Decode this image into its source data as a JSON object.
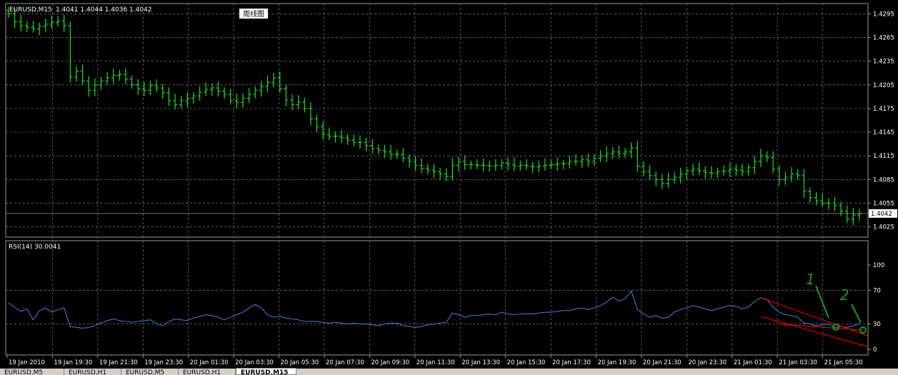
{
  "chart_data": [
    {
      "type": "bar",
      "subtype": "ohlc",
      "title": "EURUSD,M15",
      "ohlc_label": "1.4041 1.4044 1.4036 1.4042",
      "annotation": "周线图",
      "current_price_label": "1.4042",
      "ylim": [
        1.4012,
        1.4308
      ],
      "yticks": [
        "1.4295",
        "1.4265",
        "1.4235",
        "1.4205",
        "1.4175",
        "1.4145",
        "1.4115",
        "1.4085",
        "1.4055",
        "1.4025"
      ],
      "grid": true,
      "series": [
        {
          "values": [
            1.4295,
            1.4285,
            1.428,
            1.4278,
            1.4276,
            1.4279,
            1.4282,
            1.4284,
            1.4286,
            1.428,
            1.4215,
            1.4222,
            1.421,
            1.4198,
            1.4205,
            1.421,
            1.4214,
            1.4217,
            1.4218,
            1.4212,
            1.4205,
            1.42,
            1.4198,
            1.4204,
            1.4201,
            1.4195,
            1.4185,
            1.418,
            1.4185,
            1.4188,
            1.4191,
            1.4196,
            1.4199,
            1.4201,
            1.4197,
            1.4193,
            1.4185,
            1.4183,
            1.4188,
            1.4193,
            1.4198,
            1.4203,
            1.4208,
            1.4214,
            1.42,
            1.4186,
            1.418,
            1.4183,
            1.4175,
            1.4162,
            1.4152,
            1.4142,
            1.414,
            1.414,
            1.4138,
            1.4135,
            1.4132,
            1.4132,
            1.4128,
            1.4124,
            1.4122,
            1.412,
            1.4117,
            1.4117,
            1.4112,
            1.4108,
            1.4103,
            1.4099,
            1.4097,
            1.4095,
            1.4092,
            1.4089,
            1.4103,
            1.4108,
            1.4104,
            1.4104,
            1.4103,
            1.4103,
            1.4102,
            1.4103,
            1.4106,
            1.4104,
            1.4102,
            1.4103,
            1.4102,
            1.4101,
            1.4102,
            1.4103,
            1.4104,
            1.4105,
            1.4105,
            1.4108,
            1.4108,
            1.411,
            1.4108,
            1.4112,
            1.4115,
            1.4118,
            1.412,
            1.4118,
            1.412,
            1.4125,
            1.4102,
            1.4095,
            1.409,
            1.4085,
            1.408,
            1.4085,
            1.4088,
            1.4092,
            1.4096,
            1.4098,
            1.4096,
            1.4094,
            1.4093,
            1.4095,
            1.4096,
            1.4098,
            1.4097,
            1.4095,
            1.41,
            1.4108,
            1.4115,
            1.4113,
            1.4098,
            1.4085,
            1.4088,
            1.4092,
            1.409,
            1.407,
            1.4062,
            1.4058,
            1.4055,
            1.4055,
            1.4052,
            1.4045,
            1.4035,
            1.404,
            1.4042
          ]
        }
      ]
    },
    {
      "type": "line",
      "title": "RSI(14) 30.0041",
      "ylim": [
        0,
        100
      ],
      "yticks": [
        "100",
        "70",
        "30",
        "0"
      ],
      "levels": [
        70,
        30
      ],
      "grid": true,
      "series": [
        {
          "values": [
            55,
            50,
            45,
            48,
            35,
            46,
            49,
            44,
            47,
            49,
            27,
            26,
            25,
            26,
            28,
            31,
            34,
            36,
            34,
            33,
            32,
            33,
            34,
            35,
            30,
            28,
            33,
            36,
            35,
            34,
            37,
            39,
            41,
            40,
            38,
            35,
            38,
            41,
            44,
            49,
            53,
            49,
            41,
            38,
            39,
            37,
            36,
            35,
            33,
            33,
            33,
            32,
            31,
            32,
            31,
            30,
            31,
            30,
            30,
            29,
            28,
            30,
            31,
            31,
            28,
            27,
            26,
            27,
            29,
            30,
            31,
            32,
            43,
            41,
            38,
            40,
            40,
            41,
            42,
            41,
            44,
            42,
            41,
            42,
            42,
            42,
            43,
            44,
            44,
            45,
            46,
            46,
            48,
            49,
            47,
            49,
            52,
            56,
            62,
            57,
            60,
            69,
            47,
            42,
            38,
            40,
            37,
            38,
            44,
            47,
            49,
            52,
            50,
            48,
            46,
            48,
            50,
            52,
            51,
            48,
            50,
            57,
            61,
            59,
            50,
            44,
            41,
            40,
            38,
            31,
            30,
            28,
            29,
            30,
            26,
            27,
            26,
            28,
            30
          ]
        }
      ],
      "colors": {
        "line": "#4a7fd8",
        "trend": "#ff0000",
        "marker": "#1a9a1a"
      },
      "handwritten_marks": [
        "1",
        "2"
      ]
    }
  ],
  "xticks": [
    "19 Jan 2010",
    "19 Jan 19:30",
    "19 Jan 21:30",
    "19 Jan 23:30",
    "20 Jan 01:30",
    "20 Jan 03:30",
    "20 Jan 05:30",
    "20 Jan 07:30",
    "20 Jan 09:30",
    "20 Jan 11:30",
    "20 Jan 13:30",
    "20 Jan 15:30",
    "20 Jan 17:30",
    "20 Jan 19:30",
    "20 Jan 21:30",
    "20 Jan 23:30",
    "21 Jan 01:30",
    "21 Jan 03:30",
    "21 Jan 05:30"
  ],
  "tabs": [
    "EURUSD,M5",
    "EURUSD,H1",
    "EURUSD,M5",
    "EURUSD,H1",
    "EURUSD,M15"
  ],
  "colors": {
    "background": "#000000",
    "grid": "#708090",
    "bar": "#22dd22",
    "text": "#ffffff"
  }
}
